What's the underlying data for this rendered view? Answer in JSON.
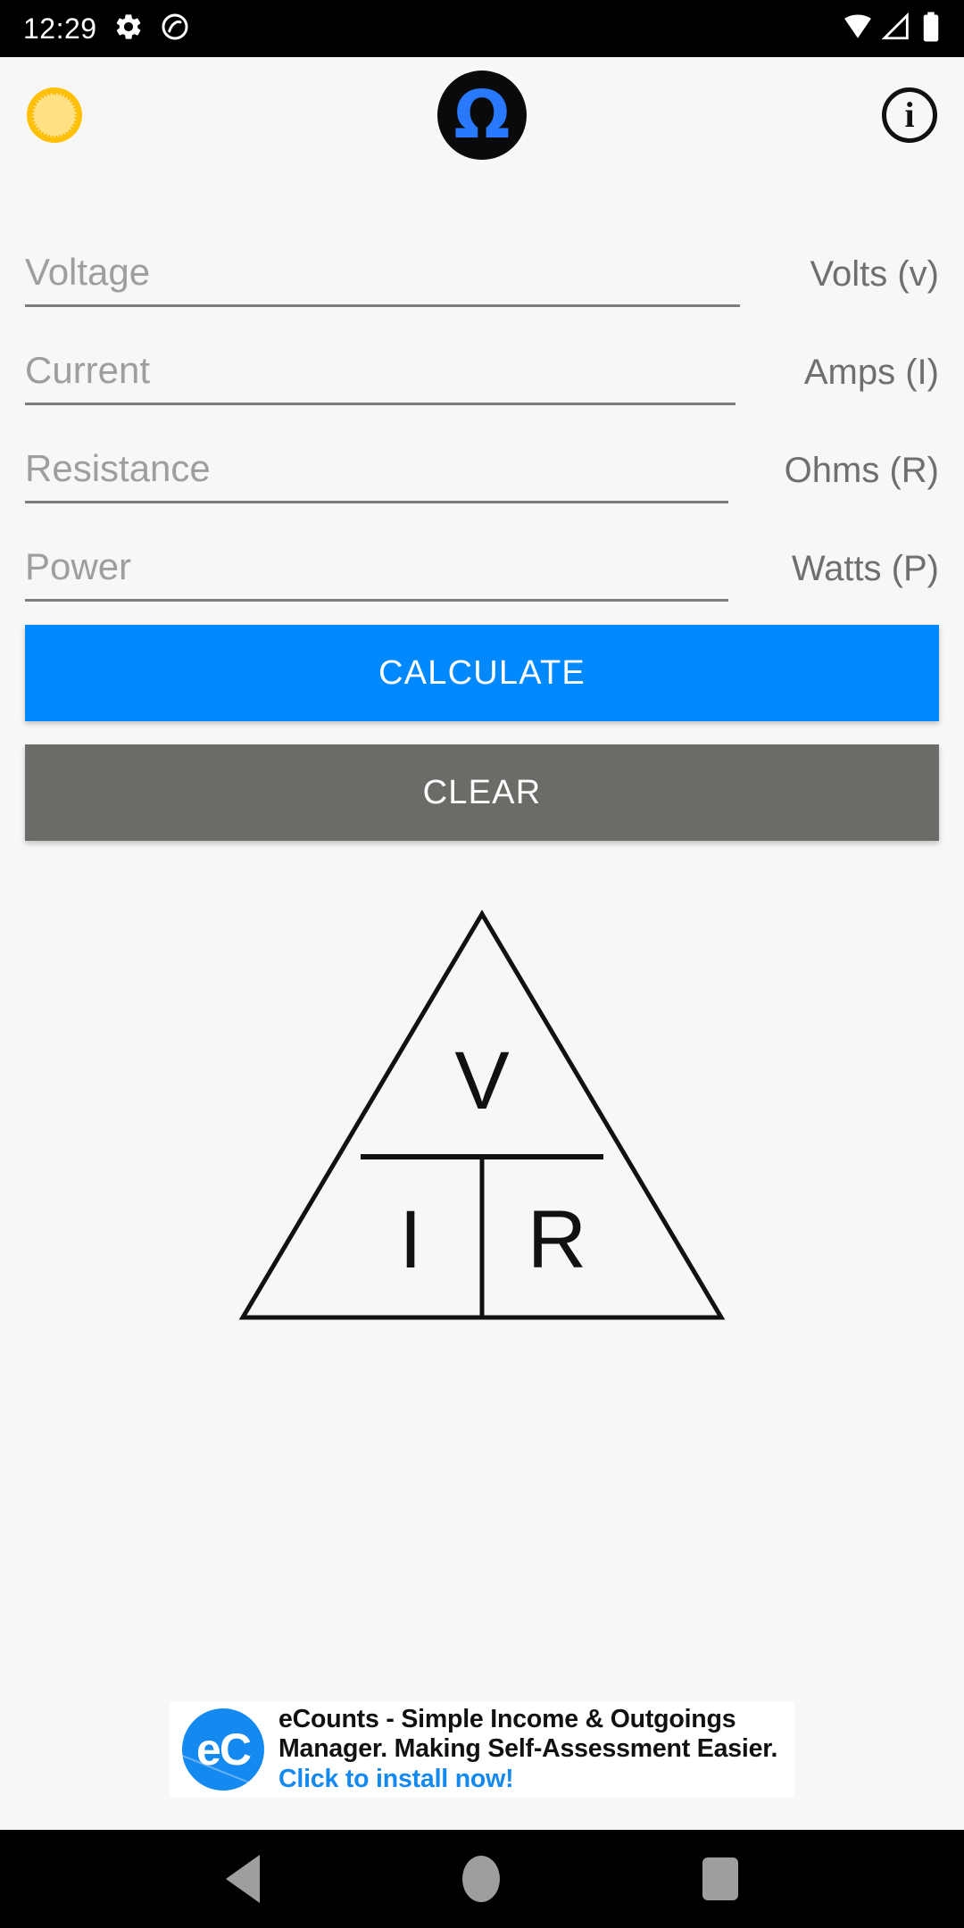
{
  "status_bar": {
    "time": "12:29",
    "icons_left": [
      "gear-icon",
      "do-not-disturb-icon"
    ],
    "icons_right": [
      "wifi-icon",
      "signal-icon",
      "battery-icon"
    ]
  },
  "header": {
    "upgrade_icon": "coin-up-arrow-icon",
    "app_logo": "omega-logo-icon",
    "app_logo_glyph": "Ω",
    "info_icon": "info-icon",
    "info_glyph": "i"
  },
  "fields": [
    {
      "id": "voltage",
      "placeholder": "Voltage",
      "value": "",
      "unit": "Volts (v)"
    },
    {
      "id": "current",
      "placeholder": "Current",
      "value": "",
      "unit": "Amps (I)"
    },
    {
      "id": "resistance",
      "placeholder": "Resistance",
      "value": "",
      "unit": "Ohms (R)"
    },
    {
      "id": "power",
      "placeholder": "Power",
      "value": "",
      "unit": "Watts (P)"
    }
  ],
  "buttons": {
    "calculate_label": "CALCULATE",
    "clear_label": "CLEAR",
    "calculate_color": "#0089FF",
    "clear_color": "#6b6b68"
  },
  "diagram": {
    "name": "ohms-law-triangle",
    "top_letter": "V",
    "bottom_left_letter": "I",
    "bottom_right_letter": "R",
    "stroke_color": "#111111"
  },
  "ad": {
    "logo_text": "eC",
    "logo_color": "#1489F0",
    "body_text": "eCounts - Simple Income & Outgoings Manager. Making Self-Assessment Easier. ",
    "cta_text": "Click to install now!",
    "cta_color": "#1489F0"
  },
  "nav_bar": {
    "back": "back-icon",
    "home": "home-icon",
    "recents": "recents-icon",
    "color": "#9e9e9e"
  },
  "theme": {
    "background": "#f7f7f7",
    "field_underline": "#7c7c7c",
    "placeholder_color": "#9e9e9e",
    "unit_color": "#6f6f6f"
  }
}
